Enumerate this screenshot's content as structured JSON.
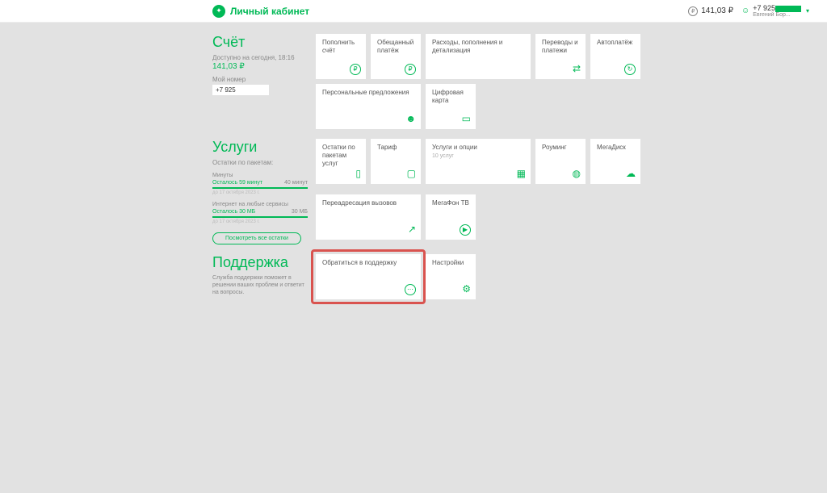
{
  "header": {
    "brand": "Личный кабинет",
    "balance": "141,03 ₽",
    "phone_prefix": "+7 925",
    "user_name": "Евгений Бор..."
  },
  "account": {
    "title": "Счёт",
    "available_label": "Доступно на сегодня, 18:16",
    "balance": "141,03 ₽",
    "my_number_label": "Мой номер",
    "my_number": "+7 925",
    "cards": {
      "topup": "Пополнить счёт",
      "promised": "Обещанный платёж",
      "expenses": "Расходы, пополнения и детализация",
      "transfers": "Переводы и платежи",
      "autopay": "Автоплатёж",
      "offers": "Персональные предложения",
      "digital_card": "Цифровая карта"
    }
  },
  "services": {
    "title": "Услуги",
    "remainders_label": "Остатки по пакетам:",
    "minutes": {
      "label": "Минуты",
      "left": "Осталось 59 минут",
      "right": "40 минут",
      "note": "до 17 октября 2023 г."
    },
    "internet": {
      "label": "Интернет на любые сервисы",
      "left": "Осталось 30 МБ",
      "right": "30 МБ",
      "note": "до 17 октября 2023 г."
    },
    "view_all_btn": "Посмотреть все остатки",
    "cards": {
      "remainders": "Остатки по пакетам услуг",
      "tariff": "Тариф",
      "options": "Услуги и опции",
      "options_sub": "10 услуг",
      "roaming": "Роуминг",
      "megadisk": "МегаДиск",
      "forwarding": "Переадресация вызовов",
      "megafon_tv": "МегаФон ТВ"
    }
  },
  "support": {
    "title": "Поддержка",
    "desc": "Служба поддержки поможет в решении ваших проблем и ответит на вопросы.",
    "contact": "Обратиться в поддержку",
    "settings": "Настройки"
  }
}
